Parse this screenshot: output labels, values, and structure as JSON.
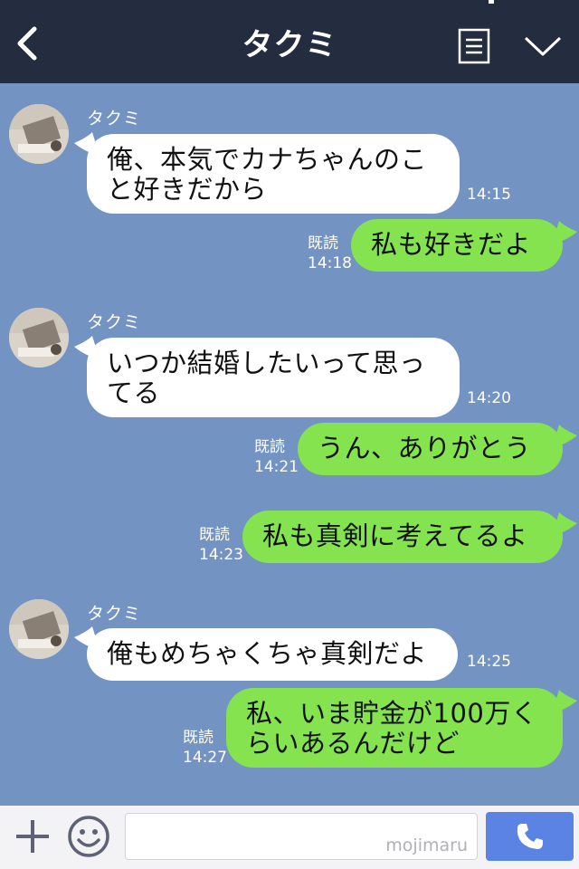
{
  "header": {
    "title": "タクミ",
    "back_icon": "chevron-left-icon",
    "menu_icon": "notes-icon",
    "dropdown_icon": "chevron-down-icon"
  },
  "messages": [
    {
      "side": "in",
      "sender": "タクミ",
      "text_lines": [
        "俺、本気でカナちゃんのこ",
        "と好きだから"
      ],
      "time": "14:15"
    },
    {
      "side": "out",
      "text": "私も好きだよ",
      "read": "既読",
      "time": "14:18"
    },
    {
      "side": "in",
      "sender": "タクミ",
      "text_lines": [
        "いつか結婚したいって思っ",
        "てる"
      ],
      "time": "14:20"
    },
    {
      "side": "out",
      "text": "うん、ありがとう",
      "read": "既読",
      "time": "14:21"
    },
    {
      "side": "out",
      "text": "私も真剣に考えてるよ",
      "read": "既読",
      "time": "14:23"
    },
    {
      "side": "in",
      "sender": "タクミ",
      "text": "俺もめちゃくちゃ真剣だよ",
      "time": "14:25"
    },
    {
      "side": "out",
      "text_lines": [
        "私、いま貯金が100万く",
        "らいあるんだけど"
      ],
      "read": "既読",
      "time": "14:27"
    }
  ],
  "footer": {
    "input_value": "",
    "watermark": "mojimaru",
    "plus_icon": "plus-icon",
    "emoji_icon": "smile-icon",
    "call_icon": "phone-icon"
  },
  "colors": {
    "header_bg": "#242c40",
    "chat_bg": "#7394c2",
    "incoming_bubble": "#ffffff",
    "outgoing_bubble": "#84e34f",
    "call_button": "#5b83e4"
  }
}
